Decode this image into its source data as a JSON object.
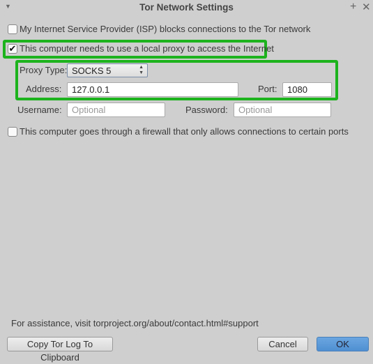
{
  "window": {
    "title": "Tor Network Settings",
    "menu_icon": "triangle-down",
    "maximize_icon": "plus",
    "close_icon": "x"
  },
  "isp_checkbox": {
    "label": "My Internet Service Provider (ISP) blocks connections to the Tor network",
    "checked": false
  },
  "proxy_checkbox": {
    "label": "This computer needs to use a local proxy to access the Internet",
    "checked": true
  },
  "proxy": {
    "type_label": "Proxy Type:",
    "type_value": "SOCKS 5",
    "address_label": "Address:",
    "address_value": "127.0.0.1",
    "port_label": "Port:",
    "port_value": "1080",
    "username_label": "Username:",
    "username_placeholder": "Optional",
    "password_label": "Password:",
    "password_placeholder": "Optional"
  },
  "firewall_checkbox": {
    "label": "This computer goes through a firewall that only allows connections to certain ports",
    "checked": false
  },
  "footer": {
    "assistance": "For assistance, visit torproject.org/about/contact.html#support",
    "copy_log": "Copy Tor Log To Clipboard",
    "cancel": "Cancel",
    "ok": "OK"
  },
  "colors": {
    "highlight": "#1db31d",
    "ok_button": "#5b9ad8"
  }
}
